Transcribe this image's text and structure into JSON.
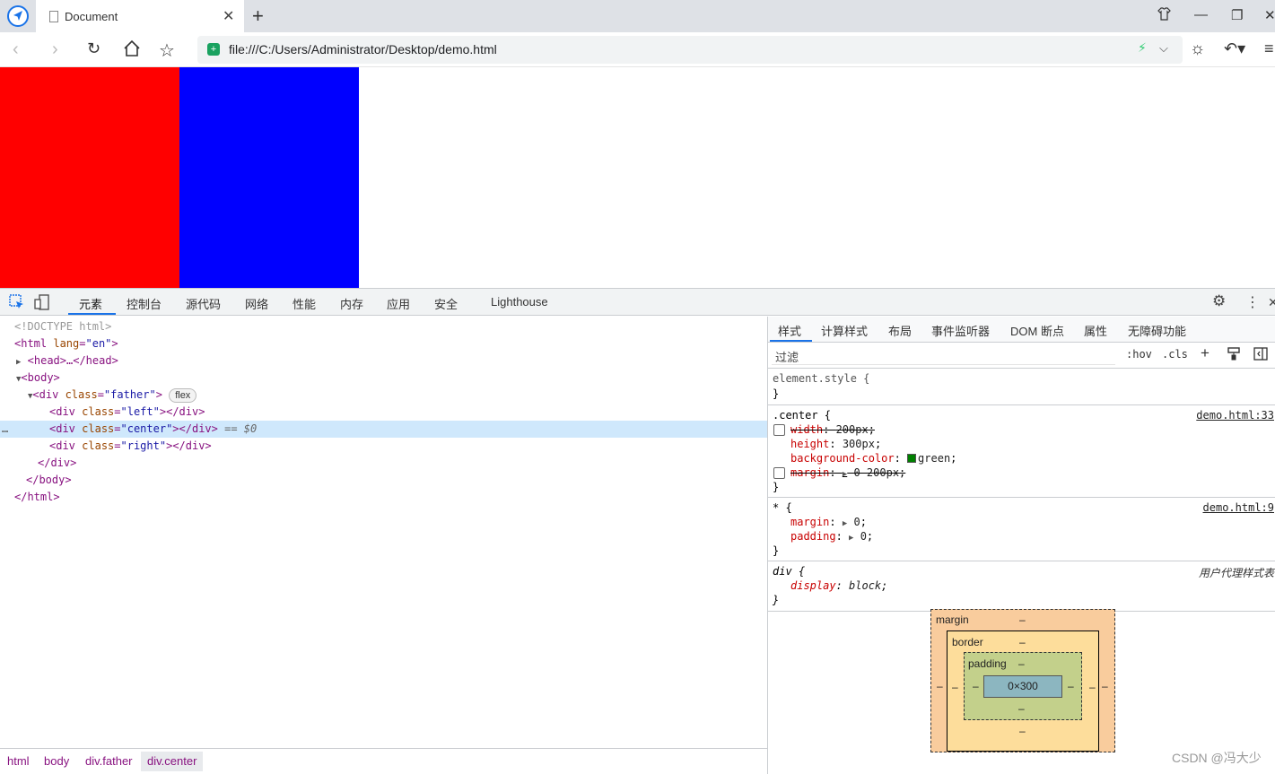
{
  "browser": {
    "tab_title": "Document",
    "url": "file:///C:/Users/Administrator/Desktop/demo.html",
    "colors": {
      "accent": "#1a73e8",
      "secure": "#1aa260"
    }
  },
  "page": {
    "left_color": "#ff0000",
    "right_color": "#0000ff"
  },
  "devtools": {
    "tabs": [
      "元素",
      "控制台",
      "源代码",
      "网络",
      "性能",
      "内存",
      "应用",
      "安全",
      "Lighthouse"
    ],
    "elements": {
      "doctype": "<!DOCTYPE html>",
      "html_open": "<html",
      "lang_attr": "lang",
      "lang_val": "\"en\"",
      "head": "<head>…</head>",
      "body_open": "<body>",
      "div_father_open": "<div",
      "class_attr": "class",
      "father_val": "\"father\"",
      "flex_badge": "flex",
      "left_val": "\"left\"",
      "center_val": "\"center\"",
      "right_val": "\"right\"",
      "div_close": "</div>",
      "gt": ">",
      "selected_suffix": "== $0",
      "body_close": "</body>",
      "html_close": "</html>",
      "dots": "…"
    },
    "breadcrumb": [
      "html",
      "body",
      "div.father",
      "div.center"
    ],
    "styles": {
      "tabs": [
        "样式",
        "计算样式",
        "布局",
        "事件监听器",
        "DOM 断点",
        "属性",
        "无障碍功能"
      ],
      "filter_placeholder": "过滤",
      "hov": ":hov",
      "cls": ".cls",
      "plus": "+",
      "element_style": "element.style {",
      "close_brace": "}",
      "center_selector": ".center {",
      "center_source": "demo.html:33",
      "center_props": [
        {
          "name": "width",
          "value": "200px",
          "struck": true
        },
        {
          "name": "height",
          "value": "300px",
          "struck": false
        },
        {
          "name": "background-color",
          "value": "green",
          "struck": false,
          "swatch": "#008000"
        },
        {
          "name": "margin",
          "value": "0 200px",
          "struck": true
        }
      ],
      "star_selector": "* {",
      "star_source": "demo.html:9",
      "star_props": [
        {
          "name": "margin",
          "value": "0"
        },
        {
          "name": "padding",
          "value": "0"
        }
      ],
      "div_selector": "div {",
      "div_source": "用户代理样式表",
      "div_props": [
        {
          "name": "display",
          "value": "block"
        }
      ]
    },
    "box_model": {
      "margin_label": "margin",
      "border_label": "border",
      "padding_label": "padding",
      "content": "0×300",
      "dash": "–"
    }
  },
  "watermark": "CSDN @冯大少"
}
